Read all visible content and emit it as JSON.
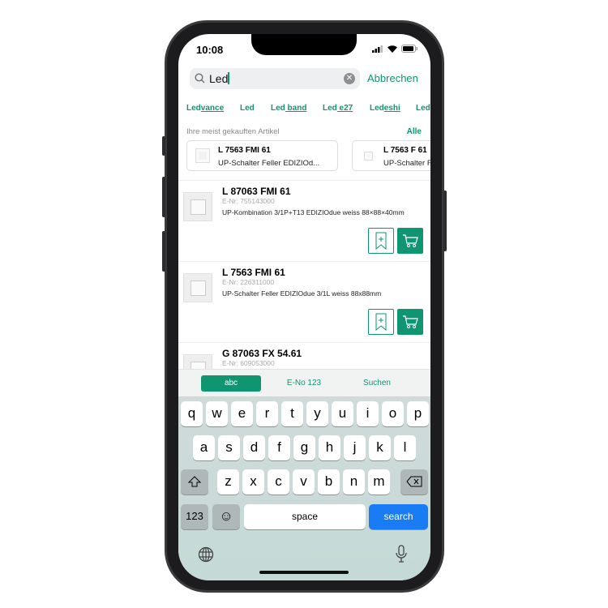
{
  "status": {
    "time": "10:08"
  },
  "search": {
    "query": "Led",
    "cancel": "Abbrechen"
  },
  "suggestions": [
    {
      "prefix": "Led",
      "rest": "vance"
    },
    {
      "prefix": "Led",
      "rest": ""
    },
    {
      "prefix": "Led",
      "rest": " band"
    },
    {
      "prefix": "Led",
      "rest": " e27"
    },
    {
      "prefix": "Led",
      "rest": "eshi"
    },
    {
      "prefix": "Led",
      "rest": ""
    }
  ],
  "frequent": {
    "header": "Ihre meist gekauften Artikel",
    "all": "Alle",
    "items": [
      {
        "title": "L 7563 FMI 61",
        "desc": "UP-Schalter Feller EDIZIOd..."
      },
      {
        "title": "L 7563 F 61",
        "desc": "UP-Schalter Feller"
      }
    ]
  },
  "results": [
    {
      "name": "L 87063 FMI 61",
      "enr": "E-Nr: 755143000",
      "desc": "UP-Kombination 3/1P+T13 EDIZIOdue weiss 88×88×40mm"
    },
    {
      "name": "L 7563 FMI 61",
      "enr": "E-Nr: 226311000",
      "desc": "UP-Schalter Feller EDIZIOdue 3/1L weiss 88x88mm"
    },
    {
      "name": "G 87063 FX 54.61",
      "enr": "E-Nr: 609053000",
      "desc": ""
    }
  ],
  "keyboard_tabs": {
    "abc": "abc",
    "eno": "E-No 123",
    "search": "Suchen",
    "active": "abc"
  },
  "keys": {
    "row1": [
      "q",
      "w",
      "e",
      "r",
      "t",
      "y",
      "u",
      "i",
      "o",
      "p"
    ],
    "row2": [
      "a",
      "s",
      "d",
      "f",
      "g",
      "h",
      "j",
      "k",
      "l"
    ],
    "row3": [
      "z",
      "x",
      "c",
      "v",
      "b",
      "n",
      "m"
    ],
    "numbers": "123",
    "space": "space",
    "search": "search"
  },
  "colors": {
    "accent": "#0f9670",
    "search_key": "#1a7cf5"
  }
}
